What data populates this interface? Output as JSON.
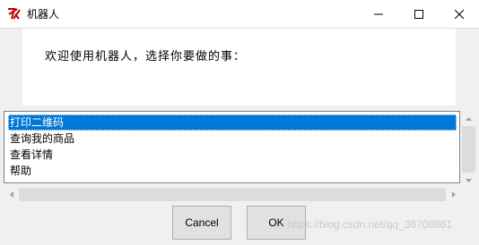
{
  "window": {
    "title": "机器人",
    "app_icon": "tk-feather-icon",
    "controls": {
      "minimize": "minimize-icon",
      "maximize": "maximize-icon",
      "close": "close-icon"
    }
  },
  "dialog": {
    "message": "欢迎使用机器人，选择你要做的事："
  },
  "listbox": {
    "items": [
      "打印二维码",
      "查询我的商品",
      "查看详情",
      "帮助"
    ],
    "selected_index": 0
  },
  "buttons": {
    "cancel_label": "Cancel",
    "ok_label": "OK"
  },
  "watermark": "https://blog.csdn.net/qq_36708861",
  "colors": {
    "selection": "#0078d7",
    "background": "#f0f0f0"
  }
}
